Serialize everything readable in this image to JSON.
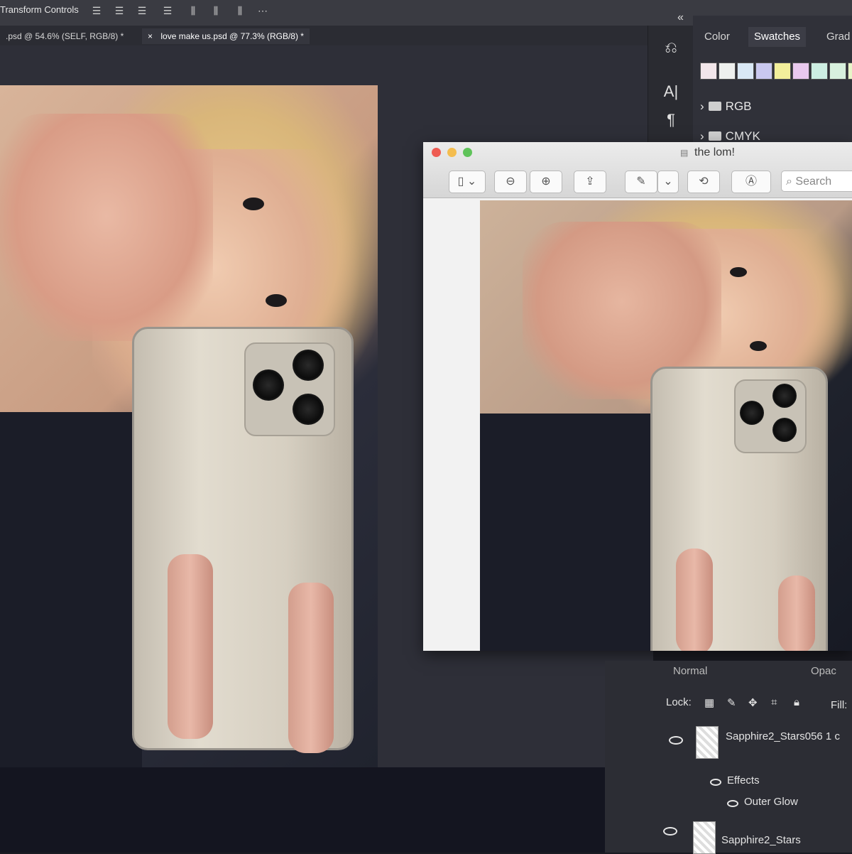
{
  "options_bar": {
    "label": "Transform Controls",
    "icons": [
      "align-left-icon",
      "align-center-icon",
      "align-right-icon",
      "align-top-icon",
      "align-middle-icon",
      "align-bottom-icon",
      "distribute-icon",
      "more-icon"
    ]
  },
  "document_tabs": [
    {
      "label": ".psd @ 54.6% (SELF, RGB/8) *",
      "active": false
    },
    {
      "label": "love make us.psd @ 77.3% (RGB/8) *",
      "active": true
    }
  ],
  "tab_close_glyph": "×",
  "right_tools": {
    "history_glyph": "⎌",
    "character_glyph": "A|",
    "paragraph_glyph": "¶"
  },
  "panel": {
    "collapse_glyph": "«",
    "tabs": [
      {
        "label": "Color",
        "active": false
      },
      {
        "label": "Swatches",
        "active": true
      },
      {
        "label": "Grad",
        "active": false
      }
    ],
    "swatch_colors": [
      "#f2e6ea",
      "#eef0ee",
      "#d9e8f5",
      "#c9c8ef",
      "#f3ef9b",
      "#e9c9ee",
      "#cdeee2",
      "#d8f1de",
      "#e7f5c8",
      "#f1d7c2"
    ],
    "folders": [
      {
        "label": "RGB",
        "chevron": "›"
      },
      {
        "label": "CMYK",
        "chevron": "›"
      }
    ]
  },
  "preview_window": {
    "title": "the lom!",
    "title_icon": "▤",
    "toolbar": {
      "sidebar_glyph": "▯ ⌄",
      "zoom_out_glyph": "⊖",
      "zoom_in_glyph": "⊕",
      "share_glyph": "⇪",
      "markup_glyph": "✎",
      "markup_menu_glyph": "⌄",
      "rotate_glyph": "⟲",
      "annotate_glyph": "Ⓐ",
      "search_placeholder": "Search",
      "search_glyph": "⌕"
    }
  },
  "layers_panel": {
    "blend_mode": "Normal",
    "opacity_label": "Opac",
    "lock_label": "Lock:",
    "fill_label": "Fill:",
    "lock_icons": [
      "checker-lock-icon",
      "brush-lock-icon",
      "move-lock-icon",
      "artboard-lock-icon",
      "padlock-icon"
    ],
    "layers": [
      {
        "name": "Sapphire2_Stars056 1 c",
        "effects_label": "Effects",
        "effect": "Outer Glow"
      },
      {
        "name": "Sapphire2_Stars"
      }
    ]
  }
}
